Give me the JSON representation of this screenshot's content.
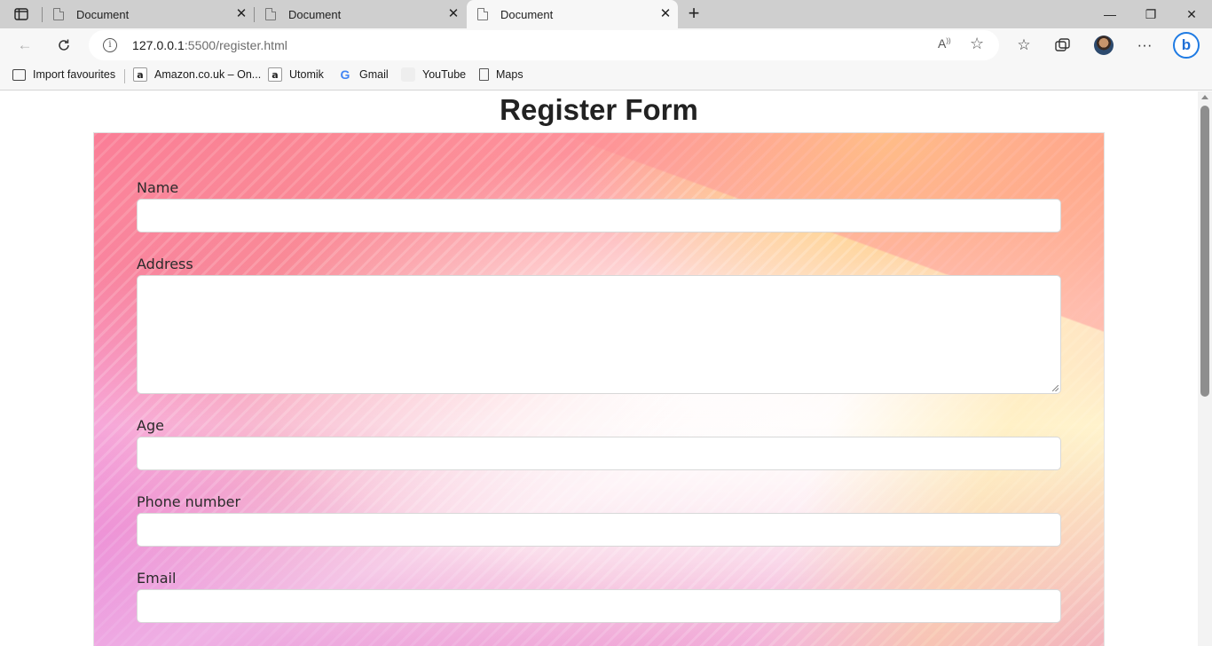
{
  "browser": {
    "tabs": [
      {
        "title": "Document",
        "active": false
      },
      {
        "title": "Document",
        "active": false
      },
      {
        "title": "Document",
        "active": true
      }
    ],
    "window_controls": {
      "minimize": "—",
      "restore": "❐",
      "close": "✕"
    },
    "address": {
      "host": "127.0.0.1",
      "rest": ":5500/register.html"
    },
    "bookmarks": [
      {
        "label": "Import favourites",
        "icon": "import-icon"
      },
      {
        "label": "Amazon.co.uk – On...",
        "icon": "amazon-icon"
      },
      {
        "label": "Utomik",
        "icon": "amazon-icon"
      },
      {
        "label": "Gmail",
        "icon": "google-icon"
      },
      {
        "label": "YouTube",
        "icon": "youtube-icon"
      },
      {
        "label": "Maps",
        "icon": "page-icon"
      }
    ]
  },
  "page": {
    "title": "Register Form",
    "fields": [
      {
        "label": "Name",
        "type": "text",
        "value": ""
      },
      {
        "label": "Address",
        "type": "textarea",
        "value": ""
      },
      {
        "label": "Age",
        "type": "text",
        "value": ""
      },
      {
        "label": "Phone number",
        "type": "text",
        "value": ""
      },
      {
        "label": "Email",
        "type": "text",
        "value": ""
      }
    ]
  }
}
